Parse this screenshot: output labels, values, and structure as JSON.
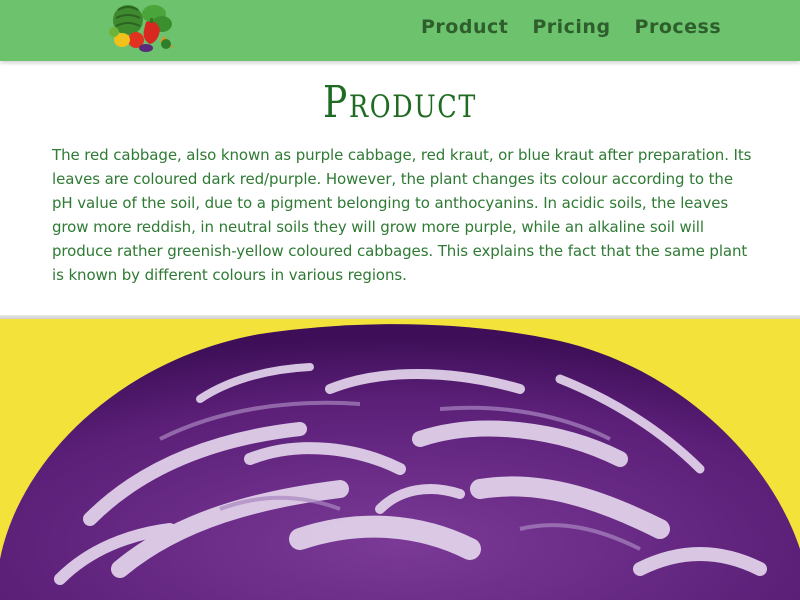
{
  "nav": {
    "logo_icon": "vegetables-logo-icon",
    "links": [
      {
        "label": "Product"
      },
      {
        "label": "Pricing"
      },
      {
        "label": "Process"
      }
    ]
  },
  "main": {
    "title": "Product",
    "description": "The red cabbage, also known as purple cabbage, red kraut, or blue kraut after preparation. Its leaves are coloured dark red/purple. However, the plant changes its colour according to the pH value of the soil, due to a pigment belonging to anthocyanins. In acidic soils, the leaves grow more reddish, in neutral soils they will grow more purple, while an alkaline soil will produce rather greenish-yellow coloured cabbages. This explains the fact that the same plant is known by different colours in various regions."
  },
  "hero": {
    "image_subject": "red-cabbage-cross-section-image"
  },
  "colors": {
    "navbar": "#6cc26d",
    "nav_text": "#2e5e2c",
    "title": "#1f6b22",
    "body_text": "#2f7a34",
    "hero_background": "#f2e23a",
    "cabbage_purple": "#5b1f78"
  }
}
